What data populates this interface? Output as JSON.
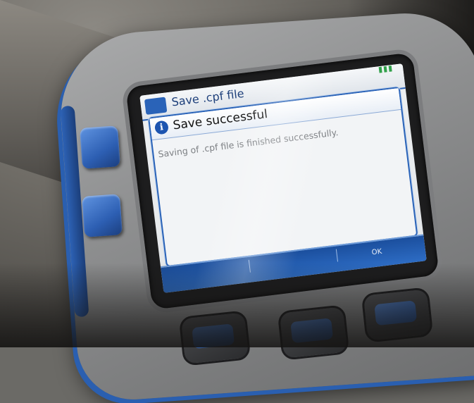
{
  "screen": {
    "header_title": "Save .cpf file",
    "status_icons": "▮▮▮",
    "dialog": {
      "title": "Save successful",
      "message": "Saving of .cpf file is finished successfully.",
      "icon": "info-icon"
    },
    "softkeys": [
      "",
      "",
      "OK"
    ]
  },
  "colors": {
    "accent": "#2a63b8",
    "device_blue": "#2d5fb3",
    "screen_bg": "#eef0f2"
  }
}
